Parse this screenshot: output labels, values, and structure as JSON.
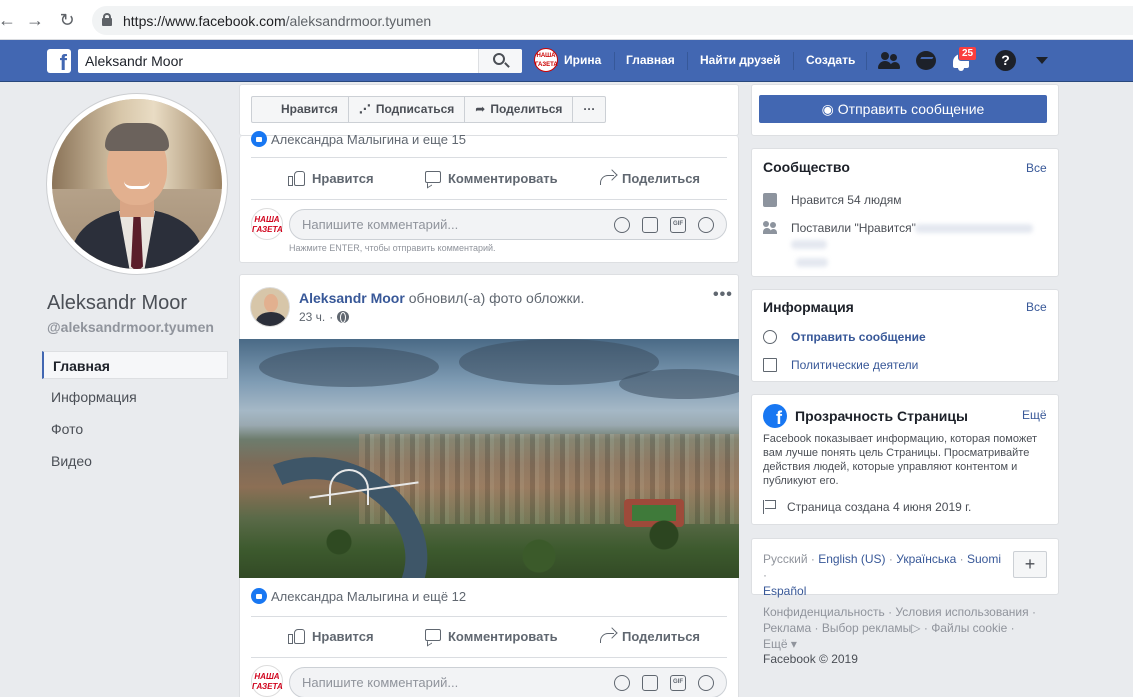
{
  "browser": {
    "url_host": "https://www.facebook.com",
    "url_path": "/aleksandrmoor.tyumen"
  },
  "fb_bar": {
    "search_value": "Aleksandr Moor",
    "user_avatar_text": "НАША ГАЗЕТА",
    "user_name": "Ирина",
    "links": [
      "Главная",
      "Найти друзей",
      "Создать"
    ],
    "notifications_count": "25",
    "help_symbol": "?",
    "brand_color": "#4267b2"
  },
  "profile": {
    "name": "Aleksandr Moor",
    "handle": "@aleksandrmoor.tyumen",
    "nav": [
      "Главная",
      "Информация",
      "Фото",
      "Видео"
    ],
    "active_nav": "Главная"
  },
  "page_actions": {
    "like": "Нравится",
    "follow": "Подписаться",
    "share": "Поделиться",
    "more": "···",
    "send_message": "Отправить сообщение"
  },
  "post1": {
    "reactions_text": "Александра Малыгина и еще 15",
    "like": "Нравится",
    "comment": "Комментировать",
    "share": "Поделиться",
    "commenter_avatar_text": "НАША ГАЗЕТА",
    "comment_placeholder": "Напишите комментарий...",
    "enter_hint": "Нажмите ENTER, чтобы отправить комментарий."
  },
  "post2": {
    "author": "Aleksandr Moor",
    "action": "обновил(-а) фото обложки.",
    "time": "23 ч.",
    "more": "•••",
    "reactions_text": "Александра Малыгина и ещё 12",
    "like": "Нравится",
    "comment": "Комментировать",
    "share": "Поделиться",
    "commenter_avatar_text": "НАША ГАЗЕТА",
    "comment_placeholder": "Напишите комментарий..."
  },
  "community": {
    "title": "Сообщество",
    "all_link": "Все",
    "likes_text": "Нравится 54 людям",
    "friends_liked": "Поставили \"Нравится\""
  },
  "info": {
    "title": "Информация",
    "all_link": "Все",
    "send_message": "Отправить сообщение",
    "category": "Политические деятели"
  },
  "transparency": {
    "title": "Прозрачность Страницы",
    "more_link": "Ещё",
    "description": "Facebook показывает информацию, которая поможет вам лучше понять цель Страницы. Просматривайте действия людей, которые управляют контентом и публикуют его.",
    "created": "Страница создана 4 июня 2019 г."
  },
  "languages": {
    "current": "Русский",
    "others": [
      "English (US)",
      "Українська",
      "Suomi",
      "Español"
    ],
    "add": "+"
  },
  "footer": {
    "links": [
      "Конфиденциальность",
      "Условия использования",
      "Реклама",
      "Выбор рекламы",
      "Файлы cookie",
      "Ещё"
    ],
    "copyright": "Facebook © 2019"
  }
}
